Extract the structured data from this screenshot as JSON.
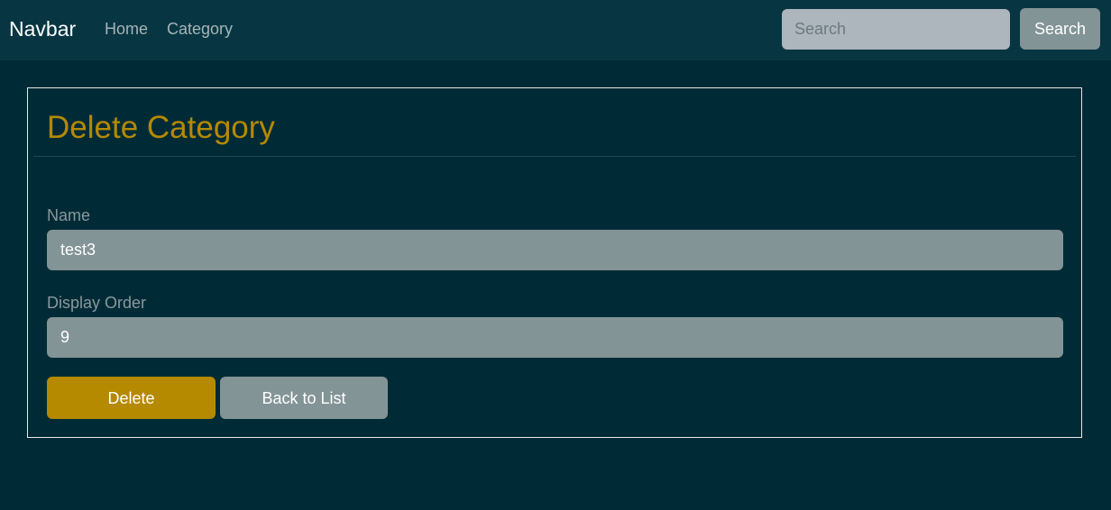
{
  "navbar": {
    "brand": "Navbar",
    "links": [
      {
        "label": "Home"
      },
      {
        "label": "Category"
      }
    ],
    "search": {
      "placeholder": "Search",
      "value": "",
      "button_label": "Search"
    }
  },
  "page": {
    "title": "Delete Category",
    "fields": [
      {
        "label": "Name",
        "value": "test3"
      },
      {
        "label": "Display Order",
        "value": "9"
      }
    ],
    "buttons": {
      "delete": "Delete",
      "back": "Back to List"
    }
  },
  "colors": {
    "background": "#002b36",
    "navbar": "#073642",
    "accent": "#b58900",
    "secondary": "#839496"
  }
}
